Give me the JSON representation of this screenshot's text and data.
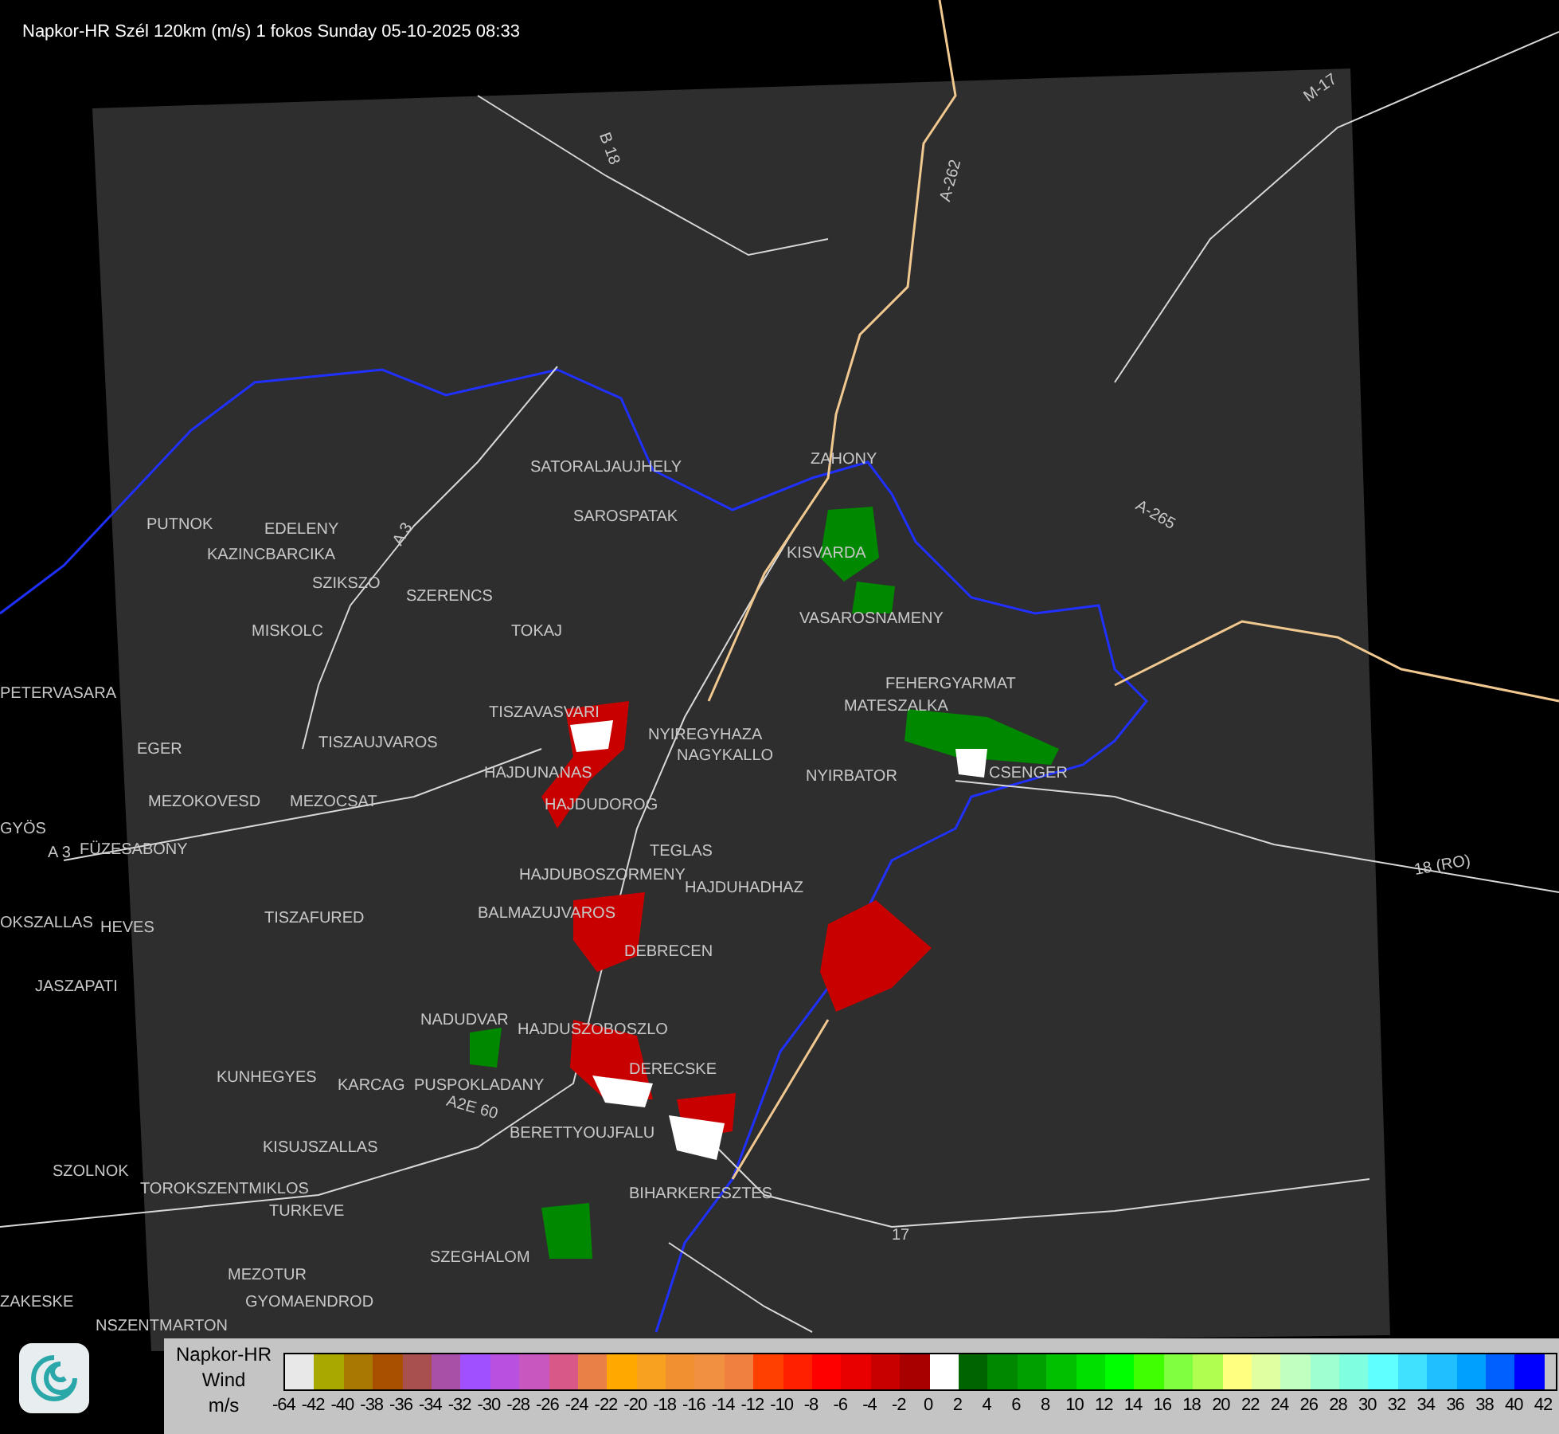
{
  "title": "Napkor-HR Szél 120km (m/s) 1 fokos Sunday 05-10-2025 08:33",
  "places": [
    {
      "name": "SATORALJAUJHELY"
    },
    {
      "name": "ZAHONY"
    },
    {
      "name": "SAROSPATAK"
    },
    {
      "name": "PUTNOK"
    },
    {
      "name": "EDELENY"
    },
    {
      "name": "KAZINCBARCIKA"
    },
    {
      "name": "SZIKSZO"
    },
    {
      "name": "SZERENCS"
    },
    {
      "name": "KISVARDA"
    },
    {
      "name": "VASAROSNAMENY"
    },
    {
      "name": "TOKAJ"
    },
    {
      "name": "MISKOLC"
    },
    {
      "name": "FEHERGYARMAT"
    },
    {
      "name": "PETERVASARA"
    },
    {
      "name": "MATESZALKA"
    },
    {
      "name": "TISZAVASVARI"
    },
    {
      "name": "EGER"
    },
    {
      "name": "TISZAUJVAROS"
    },
    {
      "name": "NYIREGYHAZA"
    },
    {
      "name": "NAGYKALLO"
    },
    {
      "name": "HAJDUNANAS"
    },
    {
      "name": "NYIRBATOR"
    },
    {
      "name": "CSENGER"
    },
    {
      "name": "MEZOKOVESD"
    },
    {
      "name": "MEZOCSAT"
    },
    {
      "name": "HAJDUDOROG"
    },
    {
      "name": "GYÖS"
    },
    {
      "name": "FÜZESABONY"
    },
    {
      "name": "TEGLAS"
    },
    {
      "name": "HAJDUBOSZORMENY"
    },
    {
      "name": "HAJDUHADHAZ"
    },
    {
      "name": "TISZAFURED"
    },
    {
      "name": "BALMAZUJVAROS"
    },
    {
      "name": "OKSZALLAS"
    },
    {
      "name": "HEVES"
    },
    {
      "name": "DEBRECEN"
    },
    {
      "name": "JASZAPATI"
    },
    {
      "name": "NADUDVAR"
    },
    {
      "name": "HAJDUSZOBOSZLO"
    },
    {
      "name": "KUNHEGYES"
    },
    {
      "name": "DERECSKE"
    },
    {
      "name": "KARCAG"
    },
    {
      "name": "PUSPOKLADANY"
    },
    {
      "name": "BERETTYOUJFALU"
    },
    {
      "name": "KISUJSZALLAS"
    },
    {
      "name": "SZOLNOK"
    },
    {
      "name": "TOROKSZENTMIKLOS"
    },
    {
      "name": "BIHARKERESZTES"
    },
    {
      "name": "TURKEVE"
    },
    {
      "name": "SZEGHALOM"
    },
    {
      "name": "MEZOTUR"
    },
    {
      "name": "ZAKESKE"
    },
    {
      "name": "GYOMAENDROD"
    },
    {
      "name": "NSZENTMARTON"
    }
  ],
  "roads": [
    {
      "name": "B 18"
    },
    {
      "name": "A-262"
    },
    {
      "name": "M-17"
    },
    {
      "name": "A-265"
    },
    {
      "name": "A 3"
    },
    {
      "name": "18 (RO)"
    },
    {
      "name": "A2E 60"
    },
    {
      "name": "17"
    },
    {
      "name": "A 3"
    }
  ],
  "legend": {
    "title_lines": [
      "Napkor-HR",
      "Wind",
      "m/s"
    ],
    "swatches": [
      {
        "color": "#e8e8e8"
      },
      {
        "color": "#a8a800"
      },
      {
        "color": "#a87800"
      },
      {
        "color": "#a85000"
      },
      {
        "color": "#a85050"
      },
      {
        "color": "#a850a8"
      },
      {
        "color": "#a050ff"
      },
      {
        "color": "#b850e0"
      },
      {
        "color": "#c858c0"
      },
      {
        "color": "#d85888"
      },
      {
        "color": "#e88048"
      },
      {
        "color": "#ffa800"
      },
      {
        "color": "#f8a020"
      },
      {
        "color": "#f09030"
      },
      {
        "color": "#f09040"
      },
      {
        "color": "#f08040"
      },
      {
        "color": "#ff4000"
      },
      {
        "color": "#ff2000"
      },
      {
        "color": "#ff0000"
      },
      {
        "color": "#e80000"
      },
      {
        "color": "#c80000"
      },
      {
        "color": "#a80000"
      },
      {
        "color": "#ffffff"
      },
      {
        "color": "#006400"
      },
      {
        "color": "#008800"
      },
      {
        "color": "#00a000"
      },
      {
        "color": "#00c000"
      },
      {
        "color": "#00e000"
      },
      {
        "color": "#00ff00"
      },
      {
        "color": "#40ff00"
      },
      {
        "color": "#80ff40"
      },
      {
        "color": "#b0ff50"
      },
      {
        "color": "#ffff80"
      },
      {
        "color": "#e0ffa0"
      },
      {
        "color": "#c0ffc0"
      },
      {
        "color": "#a0ffd0"
      },
      {
        "color": "#80ffe0"
      },
      {
        "color": "#60ffff"
      },
      {
        "color": "#40e0ff"
      },
      {
        "color": "#20c0ff"
      },
      {
        "color": "#00a0ff"
      },
      {
        "color": "#0060ff"
      },
      {
        "color": "#0000ff"
      }
    ],
    "ticks": [
      "-64",
      "-42",
      "-40",
      "-38",
      "-36",
      "-34",
      "-32",
      "-30",
      "-28",
      "-26",
      "-24",
      "-22",
      "-20",
      "-18",
      "-16",
      "-14",
      "-12",
      "-10",
      "-8",
      "-6",
      "-4",
      "-2",
      "0",
      "2",
      "4",
      "6",
      "8",
      "10",
      "12",
      "14",
      "16",
      "18",
      "20",
      "22",
      "24",
      "26",
      "28",
      "30",
      "32",
      "34",
      "36",
      "38",
      "40",
      "42"
    ]
  }
}
